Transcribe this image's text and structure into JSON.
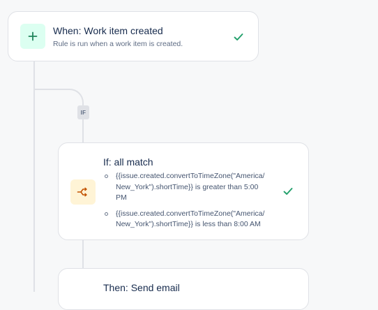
{
  "trigger": {
    "title": "When: Work item created",
    "subtitle": "Rule is run when a work item is created.",
    "icon": "plus-icon",
    "status_icon": "check-icon",
    "accent_color": "#1f845a"
  },
  "branch": {
    "tag": "IF"
  },
  "condition": {
    "title": "If: all match",
    "icon": "branch-icon",
    "status_icon": "check-icon",
    "accent_color": "#c25100",
    "items": [
      {
        "text": "{{issue.created.convertToTimeZone(\"America/ New_York\").shortTime}} is greater than 5:00 PM"
      },
      {
        "text": "{{issue.created.convertToTimeZone(\"America/ New_York\").shortTime}} is less than 8:00 AM"
      }
    ]
  },
  "action": {
    "title": "Then: Send email"
  }
}
